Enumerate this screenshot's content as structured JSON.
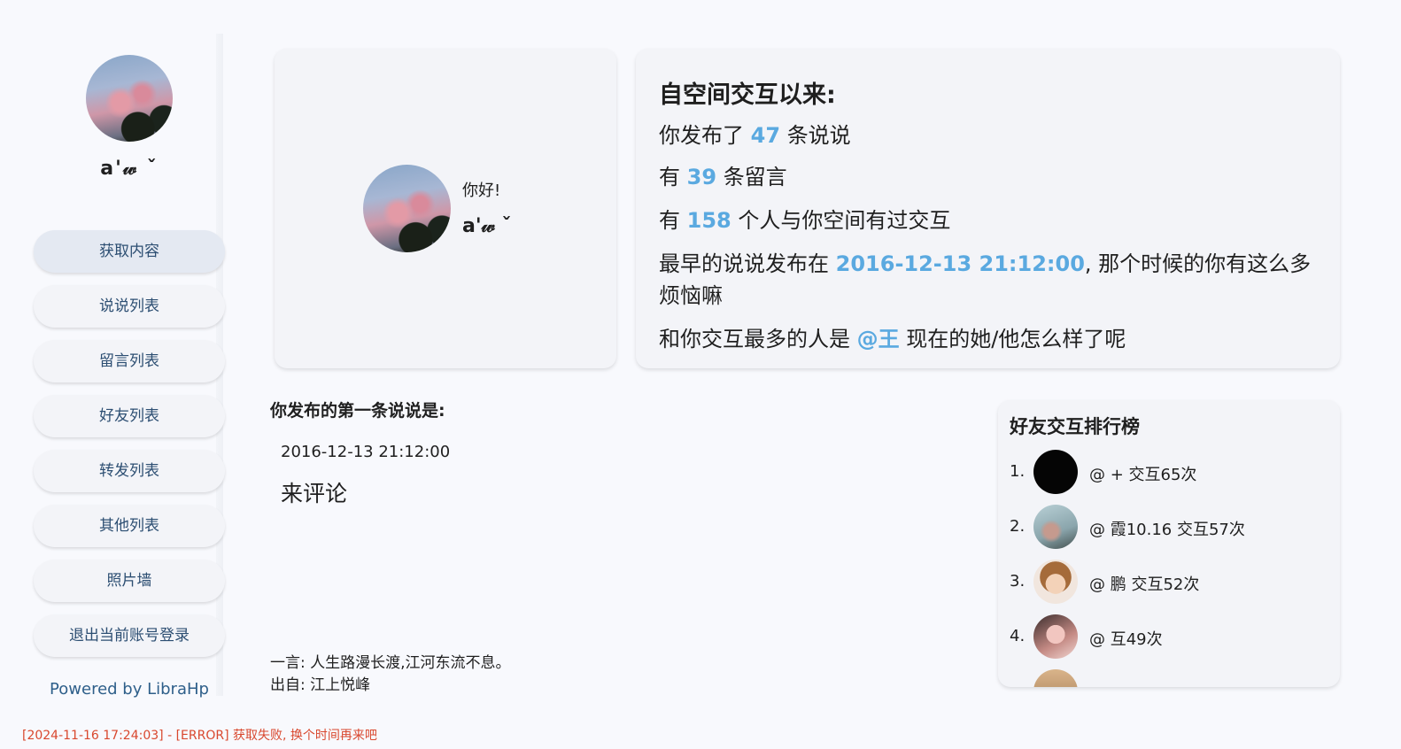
{
  "sidebar": {
    "user_name": "a'𝓌 ˇ",
    "nav": [
      {
        "label": "获取内容",
        "active": true
      },
      {
        "label": "说说列表",
        "active": false
      },
      {
        "label": "留言列表",
        "active": false
      },
      {
        "label": "好友列表",
        "active": false
      },
      {
        "label": "转发列表",
        "active": false
      },
      {
        "label": "其他列表",
        "active": false
      },
      {
        "label": "照片墙",
        "active": false
      },
      {
        "label": "退出当前账号登录",
        "active": false
      }
    ],
    "powered_by": "Powered by LibraHp"
  },
  "profile": {
    "greeting": "你好!",
    "name": "a'𝓌 ˇ"
  },
  "stats": {
    "title": "自空间交互以来:",
    "posts_prefix": "你发布了",
    "posts_count": "47",
    "posts_suffix": "条说说",
    "messages_prefix": "有",
    "messages_count": "39",
    "messages_suffix": "条留言",
    "people_prefix": "有",
    "people_count": "158",
    "people_suffix": "个人与你空间有过交互",
    "earliest_prefix": "最早的说说发布在",
    "earliest_date": "2016-12-13 21:12:00",
    "earliest_suffix": ", 那个时候的你有这么多烦恼嘛",
    "top_prefix": "和你交互最多的人是",
    "top_name": "@王",
    "top_suffix": "现在的她/他怎么样了呢"
  },
  "first_post": {
    "title": "你发布的第一条说说是:",
    "date": "2016-12-13 21:12:00",
    "content": "来评论"
  },
  "quote": {
    "text": "一言: 人生路漫长渡,江河东流不息。",
    "source": "出自: 江上悦峰"
  },
  "ranking": {
    "title": "好友交互排行榜",
    "items": [
      {
        "index": "1.",
        "text": "@ + 交互65次"
      },
      {
        "index": "2.",
        "text": "@ 霞10.16 交互57次"
      },
      {
        "index": "3.",
        "text": "@ 鹏 交互52次"
      },
      {
        "index": "4.",
        "text": "@ 互49次"
      }
    ]
  },
  "status": {
    "error": "[2024-11-16 17:24:03] - [ERROR] 获取失败, 换个时间再来吧"
  },
  "colors": {
    "accent": "#5aa9e0",
    "nav_text": "#2c4e72",
    "error": "#d9482e",
    "background": "#f8f9fd"
  }
}
